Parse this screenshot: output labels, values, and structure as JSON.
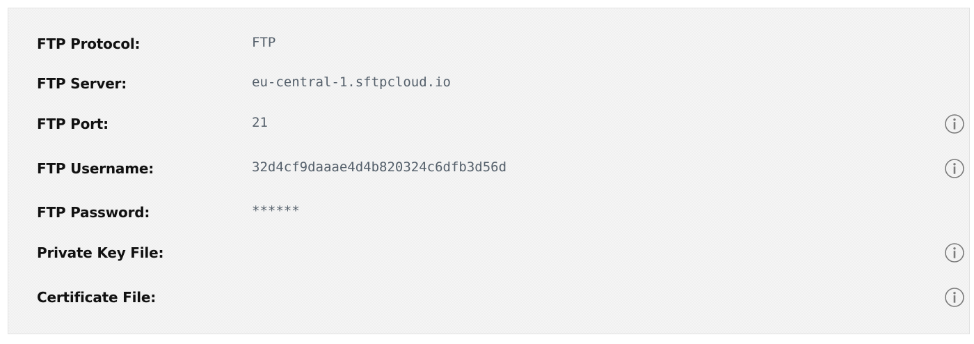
{
  "ftp_details": {
    "rows": [
      {
        "label": "FTP Protocol:",
        "value": "FTP",
        "info_icon": false
      },
      {
        "label": "FTP Server:",
        "value": "eu-central-1.sftpcloud.io",
        "info_icon": false
      },
      {
        "label": "FTP Port:",
        "value": "21",
        "info_icon": true
      },
      {
        "label": "FTP Username:",
        "value": "32d4cf9daaae4d4b820324c6dfb3d56d",
        "info_icon": true
      },
      {
        "label": "FTP Password:",
        "value": "******",
        "info_icon": false
      },
      {
        "label": "Private Key File:",
        "value": "",
        "info_icon": true
      },
      {
        "label": "Certificate File:",
        "value": "",
        "info_icon": true
      }
    ]
  },
  "icons": {
    "info": "info-circle-icon"
  },
  "colors": {
    "panel_background": "#f5f5f5",
    "panel_border": "#e2e2e2",
    "label_text": "#111111",
    "value_text": "#55606b",
    "icon_stroke": "#7a7a7a"
  }
}
